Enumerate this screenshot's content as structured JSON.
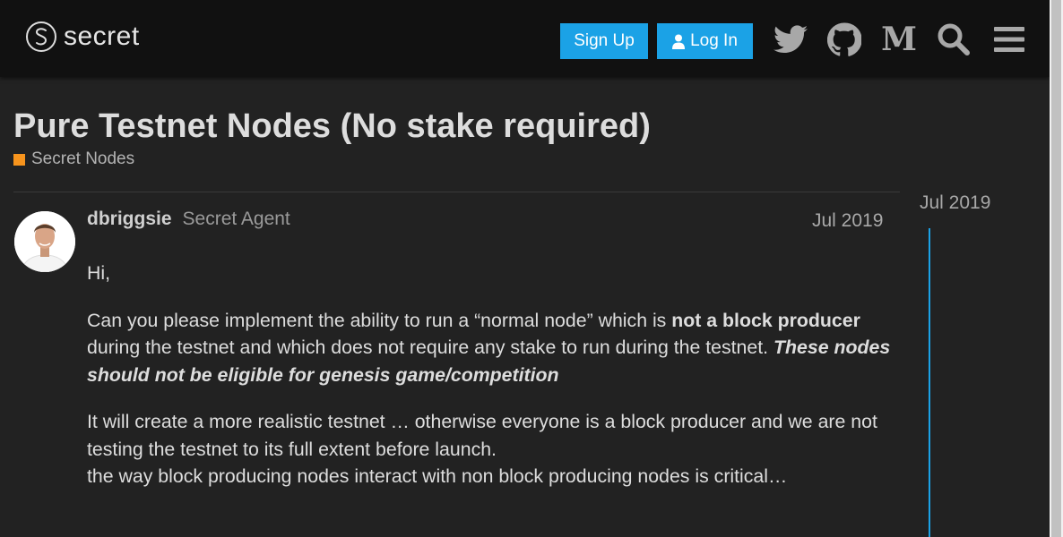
{
  "header": {
    "logo_text": "secret",
    "signup_label": "Sign Up",
    "login_label": "Log In",
    "icons": [
      "twitter-icon",
      "github-icon",
      "medium-icon",
      "search-icon",
      "hamburger-menu-icon"
    ]
  },
  "topic": {
    "title": "Pure Testnet Nodes (No stake required)",
    "category": "Secret Nodes",
    "category_color": "#f7941d"
  },
  "post": {
    "username": "dbriggsie",
    "user_title": "Secret Agent",
    "date": "Jul 2019",
    "greeting": "Hi,",
    "p2_text": "Can you please implement the ability to run a “normal node” which is ",
    "p2_bold": "not a block producer",
    "p2_text2": " during the testnet and which does not require any stake to run during the testnet. ",
    "p2_bold_italic": "These nodes should not be eligible for genesis game/competition",
    "p3_line1": "It will create a more realistic testnet … otherwise everyone is a block producer and we are not testing the testnet to its full extent before launch.",
    "p3_line2": "the way block producing nodes interact with non block producing nodes is critical…"
  },
  "timeline": {
    "date": "Jul 2019"
  },
  "colors": {
    "accent": "#1ba2e6",
    "background": "#222222",
    "header_bg": "#111111"
  }
}
